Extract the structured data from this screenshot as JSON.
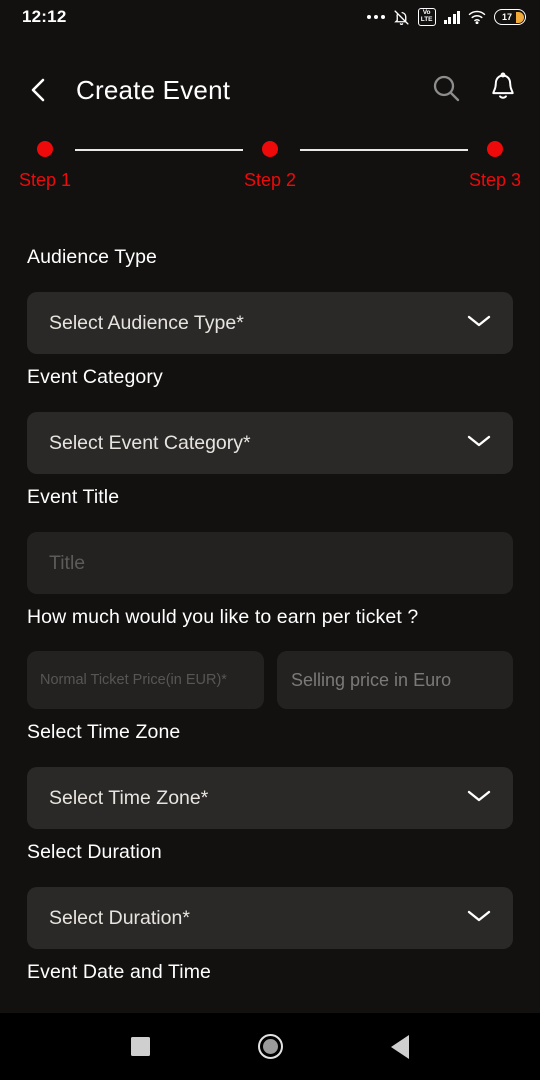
{
  "status_bar": {
    "time": "12:12",
    "battery_level": "17",
    "icons": [
      "more-dots-icon",
      "bell-muted-icon",
      "volte-icon",
      "signal-bars-icon",
      "wifi-icon",
      "battery-icon"
    ],
    "volte_top": "Vo",
    "volte_bottom": "LTE"
  },
  "header": {
    "title": "Create Event",
    "back_icon": "back-chevron-icon",
    "search_icon": "search-icon",
    "notification_icon": "bell-icon"
  },
  "stepper": {
    "accent_color": "#ee0a0a",
    "line_color": "#e8e8e8",
    "steps": [
      {
        "label": "Step 1"
      },
      {
        "label": "Step 2"
      },
      {
        "label": "Step 3"
      }
    ]
  },
  "form": {
    "audience_type": {
      "label": "Audience Type",
      "value": "Select Audience Type*",
      "chevron": "chevron-down-icon"
    },
    "event_category": {
      "label": "Event Category",
      "value": "Select Event Category*",
      "chevron": "chevron-down-icon"
    },
    "event_title": {
      "label": "Event Title",
      "placeholder": "Title",
      "value": ""
    },
    "earnings": {
      "label": "How much would you like to earn per ticket ?",
      "normal_price": {
        "placeholder": "Normal Ticket Price(in EUR)*",
        "value": ""
      },
      "selling_price": {
        "placeholder": "Selling price in Euro",
        "value": ""
      }
    },
    "time_zone": {
      "label": "Select Time Zone",
      "value": "Select Time Zone*",
      "chevron": "chevron-down-icon"
    },
    "duration": {
      "label": "Select Duration",
      "value": "Select Duration*",
      "chevron": "chevron-down-icon"
    },
    "event_date_time": {
      "label": "Event Date and Time"
    }
  },
  "nav_bar": {
    "recents_icon": "square-recents-icon",
    "home_icon": "circle-home-icon",
    "back_icon": "triangle-back-icon"
  }
}
